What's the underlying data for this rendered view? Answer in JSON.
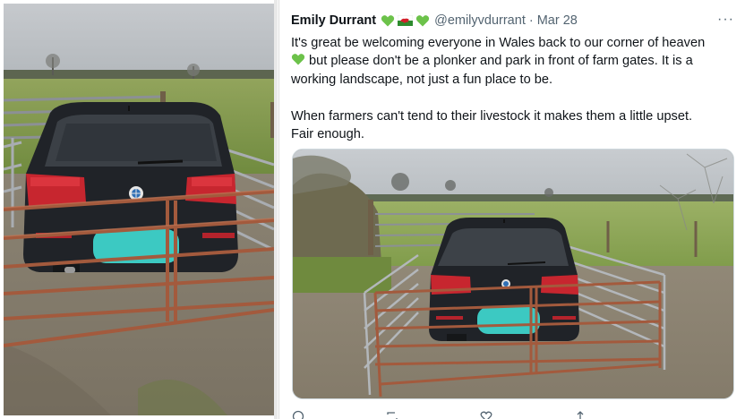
{
  "tweet": {
    "author_name": "Emily Durrant",
    "handle": "@emilyvdurrant",
    "separator": "·",
    "date": "Mar 28",
    "more_label": "···",
    "text_line1_a": "It's great be welcoming everyone in Wales back to our corner of heaven",
    "text_line2_b": "but please don't be a plonker and park in front of farm gates. It is a",
    "text_line3": "working landscape, not just a fun place to be.",
    "text_line4": "When farmers can't tend to their livestock it makes them a little upset.",
    "text_line5": "Fair enough."
  },
  "colors": {
    "heart": "#6cc24a",
    "text": "#0f1419",
    "secondary": "#536471",
    "blur": "#3cc9c2"
  },
  "icons": [
    "green-heart-icon",
    "wales-flag-icon",
    "more-icon",
    "reply-icon",
    "retweet-icon",
    "like-icon",
    "share-icon"
  ]
}
